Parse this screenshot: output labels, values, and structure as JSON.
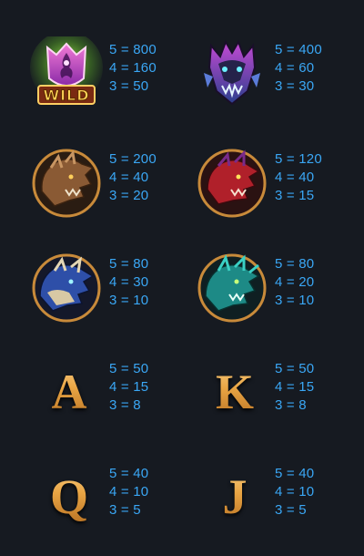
{
  "symbols": [
    {
      "name": "wild-dragon",
      "icon": "wild-dragon-emblem-icon",
      "label": "WILD",
      "rows": [
        {
          "count": "5",
          "sep": " = ",
          "value": "800"
        },
        {
          "count": "4",
          "sep": " = ",
          "value": "160"
        },
        {
          "count": "3",
          "sep": " = ",
          "value": "50"
        }
      ]
    },
    {
      "name": "purple-dragon",
      "icon": "purple-dragon-head-icon",
      "rows": [
        {
          "count": "5",
          "sep": " = ",
          "value": "400"
        },
        {
          "count": "4",
          "sep": " = ",
          "value": "60"
        },
        {
          "count": "3",
          "sep": " = ",
          "value": "30"
        }
      ]
    },
    {
      "name": "brown-dragon",
      "icon": "brown-dragon-head-icon",
      "rows": [
        {
          "count": "5",
          "sep": " = ",
          "value": "200"
        },
        {
          "count": "4",
          "sep": " = ",
          "value": "40"
        },
        {
          "count": "3",
          "sep": " = ",
          "value": "20"
        }
      ]
    },
    {
      "name": "red-dragon",
      "icon": "red-dragon-head-icon",
      "rows": [
        {
          "count": "5",
          "sep": " = ",
          "value": "120"
        },
        {
          "count": "4",
          "sep": " = ",
          "value": "40"
        },
        {
          "count": "3",
          "sep": " = ",
          "value": "15"
        }
      ]
    },
    {
      "name": "blue-dragon",
      "icon": "blue-dragon-head-icon",
      "rows": [
        {
          "count": "5",
          "sep": " = ",
          "value": "80"
        },
        {
          "count": "4",
          "sep": " = ",
          "value": "30"
        },
        {
          "count": "3",
          "sep": " = ",
          "value": "10"
        }
      ]
    },
    {
      "name": "teal-dragon",
      "icon": "teal-dragon-head-icon",
      "rows": [
        {
          "count": "5",
          "sep": " = ",
          "value": "80"
        },
        {
          "count": "4",
          "sep": " = ",
          "value": "20"
        },
        {
          "count": "3",
          "sep": " = ",
          "value": "10"
        }
      ]
    },
    {
      "name": "letter-a",
      "letter": "A",
      "rows": [
        {
          "count": "5",
          "sep": " = ",
          "value": "50"
        },
        {
          "count": "4",
          "sep": " = ",
          "value": "15"
        },
        {
          "count": "3",
          "sep": " = ",
          "value": "8"
        }
      ]
    },
    {
      "name": "letter-k",
      "letter": "K",
      "rows": [
        {
          "count": "5",
          "sep": " = ",
          "value": "50"
        },
        {
          "count": "4",
          "sep": " = ",
          "value": "15"
        },
        {
          "count": "3",
          "sep": " = ",
          "value": "8"
        }
      ]
    },
    {
      "name": "letter-q",
      "letter": "Q",
      "rows": [
        {
          "count": "5",
          "sep": " = ",
          "value": "40"
        },
        {
          "count": "4",
          "sep": " = ",
          "value": "10"
        },
        {
          "count": "3",
          "sep": " = ",
          "value": "5"
        }
      ]
    },
    {
      "name": "letter-j",
      "letter": "J",
      "rows": [
        {
          "count": "5",
          "sep": " = ",
          "value": "40"
        },
        {
          "count": "4",
          "sep": " = ",
          "value": "10"
        },
        {
          "count": "3",
          "sep": " = ",
          "value": "5"
        }
      ]
    }
  ],
  "colors": {
    "background": "#161a21",
    "payout_text": "#3aa7f5",
    "letter_gold": "#e5a64a"
  }
}
